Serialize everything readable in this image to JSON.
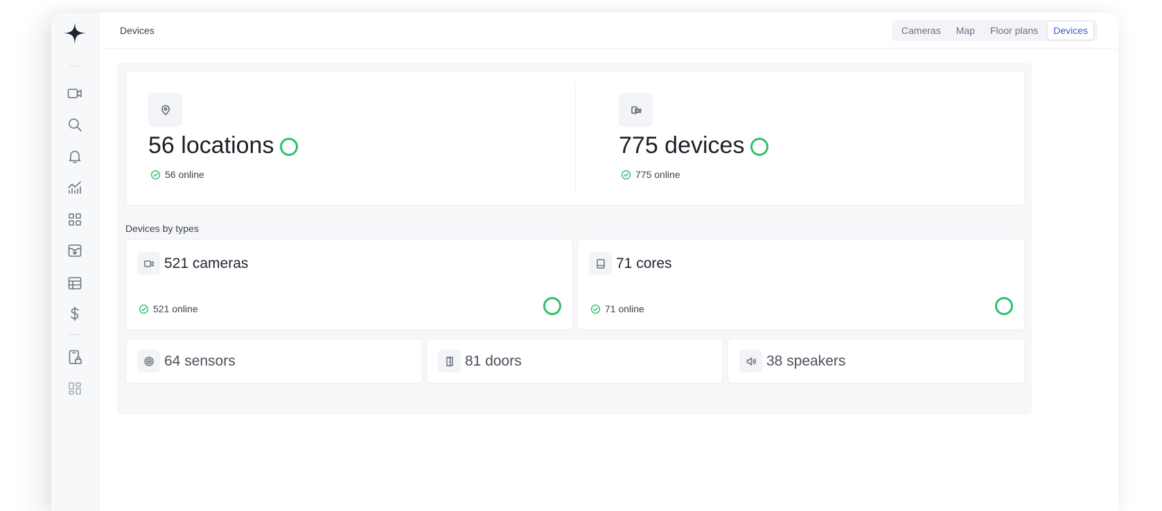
{
  "header": {
    "breadcrumb": "Devices",
    "tabs": [
      {
        "label": "Cameras",
        "active": false
      },
      {
        "label": "Map",
        "active": false
      },
      {
        "label": "Floor plans",
        "active": false
      },
      {
        "label": "Devices",
        "active": true
      }
    ]
  },
  "sidebar": {
    "logo_icon": "spark-logo-icon",
    "items": [
      {
        "icon": "video-camera-icon"
      },
      {
        "icon": "search-icon"
      },
      {
        "icon": "bell-icon"
      },
      {
        "icon": "analytics-chart-icon"
      },
      {
        "icon": "grid-icon"
      },
      {
        "icon": "archive-download-icon"
      },
      {
        "icon": "table-icon"
      },
      {
        "icon": "dollar-icon"
      },
      {
        "icon": "badge-lock-icon"
      },
      {
        "icon": "dashboard-layout-icon"
      }
    ]
  },
  "summary": {
    "locations": {
      "title": "56 locations",
      "online": "56 online",
      "icon": "location-pin-icon"
    },
    "devices": {
      "title": "775 devices",
      "online": "775 online",
      "icon": "devices-icon"
    }
  },
  "devices_by_types": {
    "title": "Devices by types",
    "cameras": {
      "title": "521 cameras",
      "online": "521 online",
      "icon": "camera-icon"
    },
    "cores": {
      "title": "71 cores",
      "online": "71 online",
      "icon": "core-icon"
    },
    "sensors": {
      "title": "64 sensors",
      "icon": "sensor-icon"
    },
    "doors": {
      "title": "81 doors",
      "icon": "door-icon"
    },
    "speakers": {
      "title": "38 speakers",
      "icon": "speaker-icon"
    }
  },
  "colors": {
    "status_online": "#2fbf6a",
    "active_tab": "#3b5bcc",
    "text_primary": "#1b1f27"
  }
}
